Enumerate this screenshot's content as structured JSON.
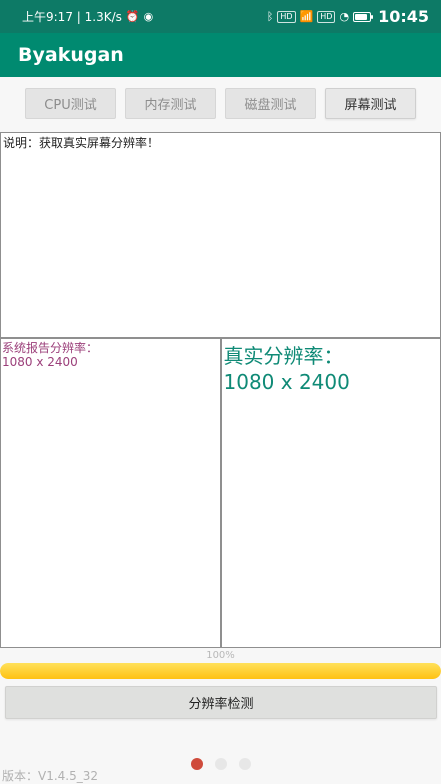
{
  "status_bar": {
    "left_text": "上午9:17 | 1.3K/s",
    "right_time": "10:45",
    "indicator_hd": "HD",
    "indicator_hd2": "HD"
  },
  "app_bar": {
    "title": "Byakugan"
  },
  "tabs": [
    {
      "label": "CPU测试"
    },
    {
      "label": "内存测试"
    },
    {
      "label": "磁盘测试"
    },
    {
      "label": "屏幕测试"
    }
  ],
  "description": {
    "text": "说明：获取真实屏幕分辨率！"
  },
  "resolution": {
    "reported_label": "系统报告分辨率：",
    "reported_value": "1080 x 2400",
    "real_label": "真实分辨率：",
    "real_value": "1080 x 2400"
  },
  "progress": {
    "text": "100%",
    "value": 100
  },
  "actions": {
    "detect_button": "分辨率检测"
  },
  "version": {
    "text": "版本：V1.4.5_32"
  }
}
